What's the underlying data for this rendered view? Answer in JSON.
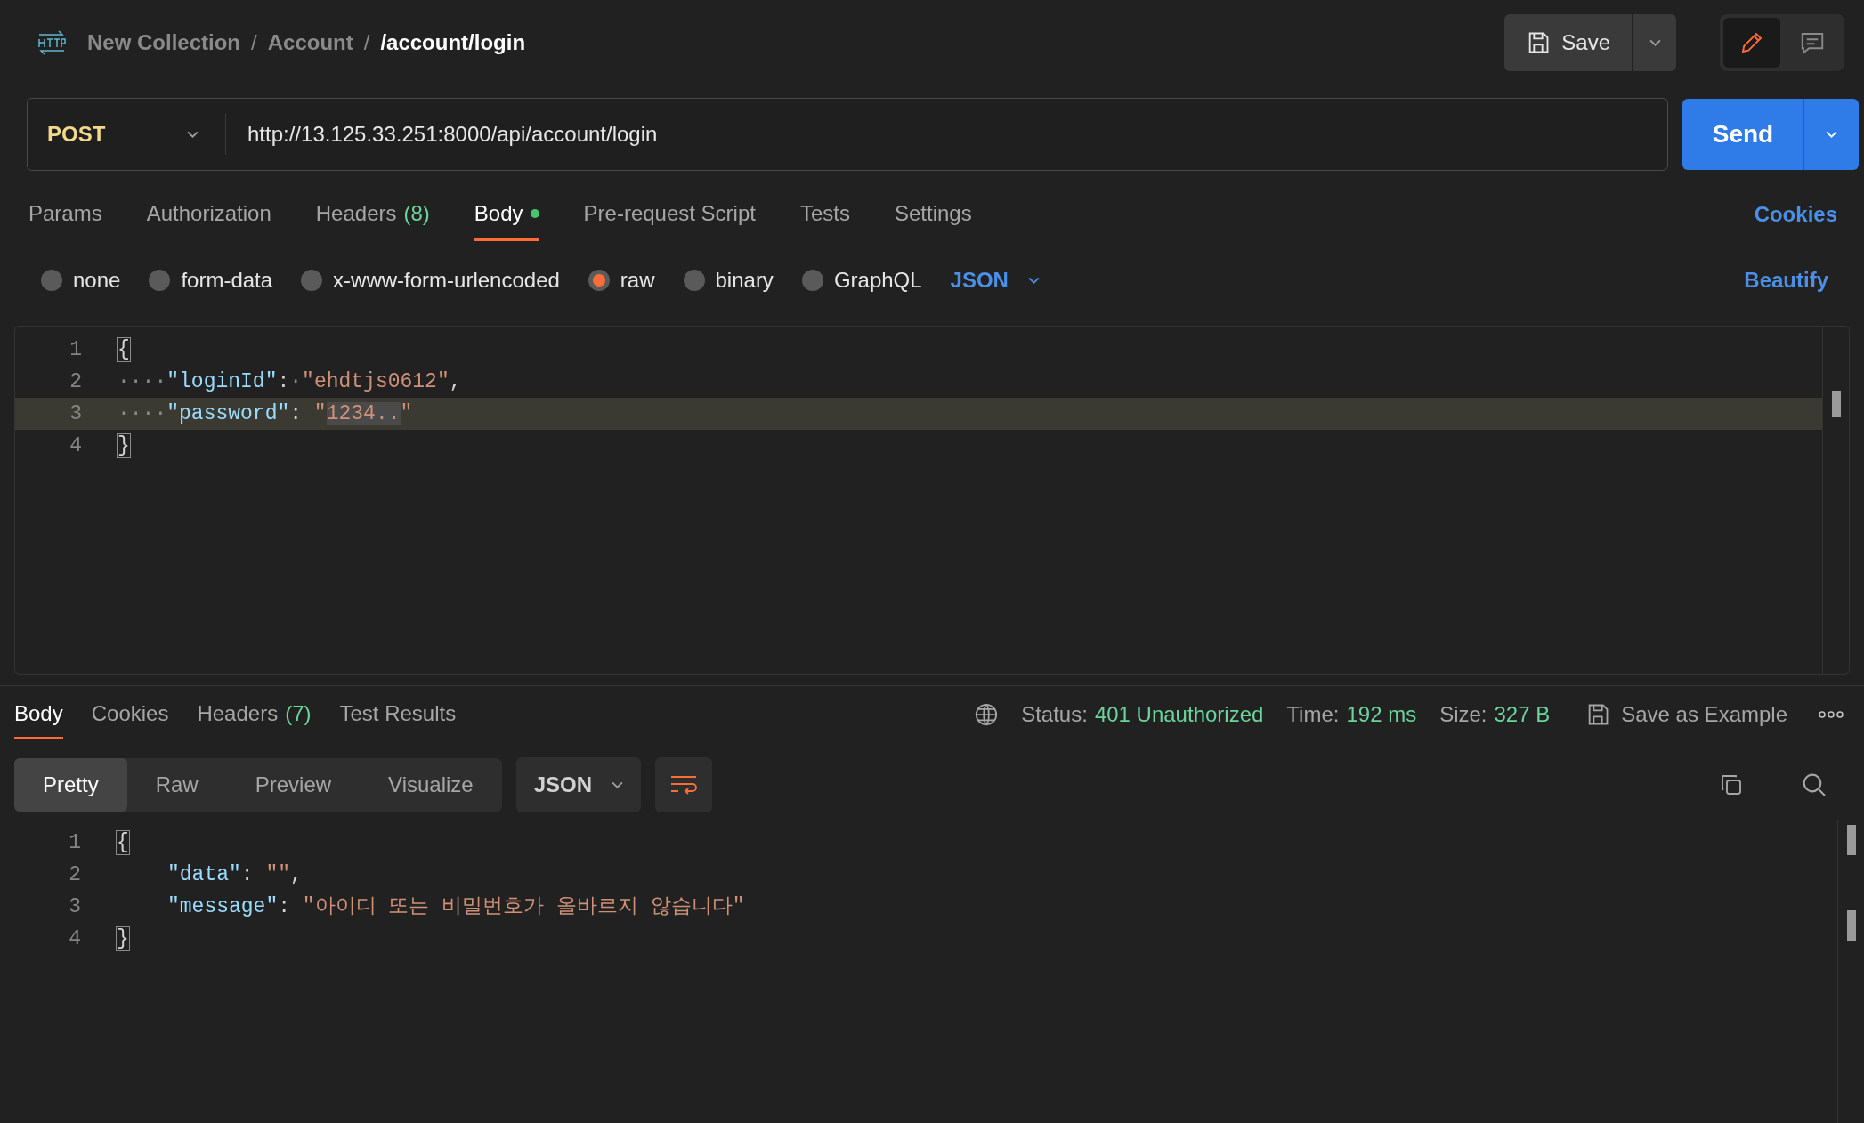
{
  "breadcrumb": [
    {
      "kind": "link",
      "label": "New Collection"
    },
    {
      "kind": "separator",
      "label": "/"
    },
    {
      "kind": "link",
      "label": "Account"
    },
    {
      "kind": "separator",
      "label": "/"
    },
    {
      "kind": "current",
      "label": "/account/login"
    }
  ],
  "save_button": "Save",
  "mode_buttons": [
    {
      "kind": "edit",
      "selected": true
    },
    {
      "kind": "comment",
      "selected": false
    }
  ],
  "request": {
    "method": "POST",
    "url": "http://13.125.33.251:8000/api/account/login",
    "send": "Send"
  },
  "request_tabs": [
    {
      "label": "Params",
      "selected": false
    },
    {
      "label": "Authorization",
      "selected": false
    },
    {
      "label": "Headers",
      "count": "(8)",
      "selected": false
    },
    {
      "label": "Body",
      "selected": true,
      "dot": true
    },
    {
      "label": "Pre-request Script",
      "selected": false
    },
    {
      "label": "Tests",
      "selected": false
    },
    {
      "label": "Settings",
      "selected": false
    }
  ],
  "cookies_link": "Cookies",
  "body_types": [
    {
      "label": "none",
      "selected": false
    },
    {
      "label": "form-data",
      "selected": false
    },
    {
      "label": "x-www-form-urlencoded",
      "selected": false
    },
    {
      "label": "raw",
      "selected": true
    },
    {
      "label": "binary",
      "selected": false
    },
    {
      "label": "GraphQL",
      "selected": false
    }
  ],
  "language": "JSON",
  "beautify": "Beautify",
  "request_body": [
    {
      "number": "1",
      "highlighted": false,
      "tokens": [
        {
          "kind": "brace",
          "text": "{"
        }
      ]
    },
    {
      "number": "2",
      "highlighted": false,
      "tokens": [
        {
          "kind": "ws",
          "text": "····"
        },
        {
          "kind": "key",
          "text": "\"loginId\""
        },
        {
          "kind": "punct",
          "text": ":"
        },
        {
          "kind": "ws",
          "text": "·"
        },
        {
          "kind": "string",
          "text": "\"ehdtjs0612\""
        },
        {
          "kind": "punct",
          "text": ","
        }
      ]
    },
    {
      "number": "3",
      "highlighted": true,
      "tokens": [
        {
          "kind": "ws",
          "text": "····"
        },
        {
          "kind": "key",
          "text": "\"password\""
        },
        {
          "kind": "punct",
          "text": ": "
        },
        {
          "kind": "string",
          "text": "\""
        },
        {
          "kind": "selection",
          "text": "1234.."
        },
        {
          "kind": "string",
          "text": "\""
        }
      ]
    },
    {
      "number": "4",
      "highlighted": false,
      "tokens": [
        {
          "kind": "brace",
          "text": "}"
        }
      ]
    }
  ],
  "response_tabs": [
    {
      "label": "Body",
      "selected": true
    },
    {
      "label": "Cookies",
      "selected": false
    },
    {
      "label": "Headers",
      "count": "(7)",
      "selected": false
    },
    {
      "label": "Test Results",
      "selected": false
    }
  ],
  "status": [
    {
      "label": "Status:",
      "value": "401 Unauthorized"
    },
    {
      "label": "Time:",
      "value": "192 ms"
    },
    {
      "label": "Size:",
      "value": "327 B"
    }
  ],
  "save_as_example": "Save as Example",
  "view_modes": [
    {
      "label": "Pretty",
      "selected": true
    },
    {
      "label": "Raw",
      "selected": false
    },
    {
      "label": "Preview",
      "selected": false
    },
    {
      "label": "Visualize",
      "selected": false
    }
  ],
  "response_format": "JSON",
  "response_body": [
    {
      "number": "1",
      "highlighted": false,
      "tokens": [
        {
          "kind": "brace",
          "text": "{"
        }
      ]
    },
    {
      "number": "2",
      "highlighted": false,
      "indented": true,
      "tokens": [
        {
          "kind": "key",
          "text": "\"data\""
        },
        {
          "kind": "punct",
          "text": ": "
        },
        {
          "kind": "string",
          "text": "\"\""
        },
        {
          "kind": "punct",
          "text": ","
        }
      ]
    },
    {
      "number": "3",
      "highlighted": false,
      "indented": true,
      "tokens": [
        {
          "kind": "key",
          "text": "\"message\""
        },
        {
          "kind": "punct",
          "text": ": "
        },
        {
          "kind": "string",
          "text": "\"아이디 또는 비밀번호가 올바르지 않습니다\""
        }
      ]
    },
    {
      "number": "4",
      "highlighted": false,
      "tokens": [
        {
          "kind": "brace",
          "text": "}"
        }
      ]
    }
  ]
}
